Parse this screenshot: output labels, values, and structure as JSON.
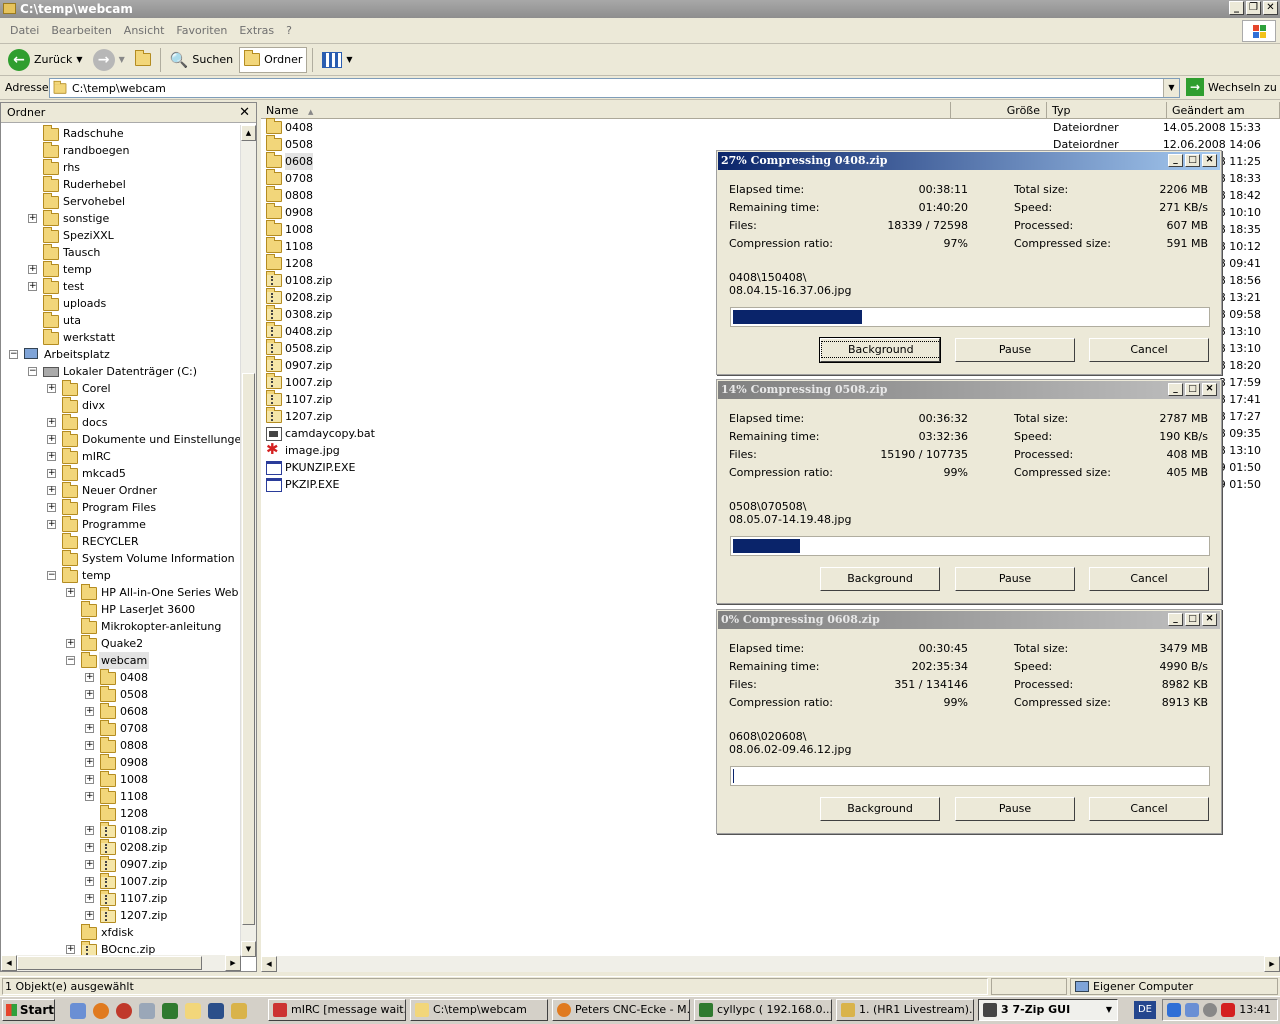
{
  "window": {
    "title": "C:\\temp\\webcam"
  },
  "menu": [
    "Datei",
    "Bearbeiten",
    "Ansicht",
    "Favoriten",
    "Extras",
    "?"
  ],
  "toolbar": {
    "back": "Zurück",
    "search": "Suchen",
    "folders": "Ordner"
  },
  "address": {
    "label": "Adresse",
    "value": "C:\\temp\\webcam",
    "go": "Wechseln zu"
  },
  "folder_pane": {
    "title": "Ordner"
  },
  "tree": [
    {
      "label": "Radschuhe",
      "indent": 1,
      "exp": ""
    },
    {
      "label": "randboegen",
      "indent": 1,
      "exp": ""
    },
    {
      "label": "rhs",
      "indent": 1,
      "exp": ""
    },
    {
      "label": "Ruderhebel",
      "indent": 1,
      "exp": ""
    },
    {
      "label": "Servohebel",
      "indent": 1,
      "exp": ""
    },
    {
      "label": "sonstige",
      "indent": 1,
      "exp": "+"
    },
    {
      "label": "SpeziXXL",
      "indent": 1,
      "exp": ""
    },
    {
      "label": "Tausch",
      "indent": 1,
      "exp": ""
    },
    {
      "label": "temp",
      "indent": 1,
      "exp": "+"
    },
    {
      "label": "test",
      "indent": 1,
      "exp": "+"
    },
    {
      "label": "uploads",
      "indent": 1,
      "exp": ""
    },
    {
      "label": "uta",
      "indent": 1,
      "exp": ""
    },
    {
      "label": "werkstatt",
      "indent": 1,
      "exp": ""
    },
    {
      "label": "Arbeitsplatz",
      "indent": 0,
      "exp": "-",
      "icon": "pc"
    },
    {
      "label": "Lokaler Datenträger (C:)",
      "indent": 1,
      "exp": "-",
      "icon": "drive"
    },
    {
      "label": "Corel",
      "indent": 2,
      "exp": "+"
    },
    {
      "label": "divx",
      "indent": 2,
      "exp": ""
    },
    {
      "label": "docs",
      "indent": 2,
      "exp": "+"
    },
    {
      "label": "Dokumente und Einstellungen",
      "indent": 2,
      "exp": "+"
    },
    {
      "label": "mIRC",
      "indent": 2,
      "exp": "+"
    },
    {
      "label": "mkcad5",
      "indent": 2,
      "exp": "+"
    },
    {
      "label": "Neuer Ordner",
      "indent": 2,
      "exp": "+"
    },
    {
      "label": "Program Files",
      "indent": 2,
      "exp": "+"
    },
    {
      "label": "Programme",
      "indent": 2,
      "exp": "+"
    },
    {
      "label": "RECYCLER",
      "indent": 2,
      "exp": ""
    },
    {
      "label": "System Volume Information",
      "indent": 2,
      "exp": ""
    },
    {
      "label": "temp",
      "indent": 2,
      "exp": "-"
    },
    {
      "label": "HP All-in-One Series Web Rel",
      "indent": 3,
      "exp": "+"
    },
    {
      "label": "HP LaserJet 3600",
      "indent": 3,
      "exp": ""
    },
    {
      "label": "Mikrokopter-anleitung",
      "indent": 3,
      "exp": ""
    },
    {
      "label": "Quake2",
      "indent": 3,
      "exp": "+"
    },
    {
      "label": "webcam",
      "indent": 3,
      "exp": "-",
      "sel": true
    },
    {
      "label": "0408",
      "indent": 4,
      "exp": "+"
    },
    {
      "label": "0508",
      "indent": 4,
      "exp": "+"
    },
    {
      "label": "0608",
      "indent": 4,
      "exp": "+"
    },
    {
      "label": "0708",
      "indent": 4,
      "exp": "+"
    },
    {
      "label": "0808",
      "indent": 4,
      "exp": "+"
    },
    {
      "label": "0908",
      "indent": 4,
      "exp": "+"
    },
    {
      "label": "1008",
      "indent": 4,
      "exp": "+"
    },
    {
      "label": "1108",
      "indent": 4,
      "exp": "+"
    },
    {
      "label": "1208",
      "indent": 4,
      "exp": ""
    },
    {
      "label": "0108.zip",
      "indent": 4,
      "exp": "+",
      "icon": "zip"
    },
    {
      "label": "0208.zip",
      "indent": 4,
      "exp": "+",
      "icon": "zip"
    },
    {
      "label": "0907.zip",
      "indent": 4,
      "exp": "+",
      "icon": "zip"
    },
    {
      "label": "1007.zip",
      "indent": 4,
      "exp": "+",
      "icon": "zip"
    },
    {
      "label": "1107.zip",
      "indent": 4,
      "exp": "+",
      "icon": "zip"
    },
    {
      "label": "1207.zip",
      "indent": 4,
      "exp": "+",
      "icon": "zip"
    },
    {
      "label": "xfdisk",
      "indent": 3,
      "exp": ""
    },
    {
      "label": "BOcnc.zip",
      "indent": 3,
      "exp": "+",
      "icon": "zip"
    }
  ],
  "columns": {
    "name": "Name",
    "size": "Größe",
    "type": "Typ",
    "modified": "Geändert am"
  },
  "files": [
    {
      "name": "0408",
      "icon": "folder"
    },
    {
      "name": "0508",
      "icon": "folder"
    },
    {
      "name": "0608",
      "icon": "folder",
      "sel": true
    },
    {
      "name": "0708",
      "icon": "folder"
    },
    {
      "name": "0808",
      "icon": "folder"
    },
    {
      "name": "0908",
      "icon": "folder"
    },
    {
      "name": "1008",
      "icon": "folder"
    },
    {
      "name": "1108",
      "icon": "folder"
    },
    {
      "name": "1208",
      "icon": "folder"
    },
    {
      "name": "0108.zip",
      "icon": "zip"
    },
    {
      "name": "0208.zip",
      "icon": "zip"
    },
    {
      "name": "0308.zip",
      "icon": "zip"
    },
    {
      "name": "0408.zip",
      "icon": "zip"
    },
    {
      "name": "0508.zip",
      "icon": "zip"
    },
    {
      "name": "0907.zip",
      "icon": "zip"
    },
    {
      "name": "1007.zip",
      "icon": "zip"
    },
    {
      "name": "1107.zip",
      "icon": "zip"
    },
    {
      "name": "1207.zip",
      "icon": "zip"
    },
    {
      "name": "camdaycopy.bat",
      "icon": "bat"
    },
    {
      "name": "image.jpg",
      "icon": "img"
    },
    {
      "name": "PKUNZIP.EXE",
      "icon": "exe"
    },
    {
      "name": "PKZIP.EXE",
      "icon": "exe"
    }
  ],
  "visible_types": [
    "Dateiordner",
    "Dateiordner"
  ],
  "visible_dates": [
    "14.05.2008 15:33",
    "12.06.2008 14:06",
    "8 11:25",
    "8 18:33",
    "8 18:42",
    "8 10:10",
    "8 18:35",
    "8 10:12",
    "8 09:41",
    "8 18:56",
    "8 13:21",
    "8 09:58",
    "8 13:10",
    "8 13:10",
    "8 18:20",
    "8 17:59",
    "8 17:41",
    "8 17:27",
    "8 09:35",
    "8 13:10",
    "9 01:50",
    "9 01:50"
  ],
  "dialogs": [
    {
      "title": "27% Compressing 0408.zip",
      "active": true,
      "elapsed": "00:38:11",
      "remaining": "01:40:20",
      "files": "18339 / 72598",
      "ratio": "97%",
      "total": "2206 MB",
      "speed": "271 KB/s",
      "processed": "607 MB",
      "compressed": "591 MB",
      "path1": "0408\\150408\\",
      "path2": "08.04.15-16.37.06.jpg",
      "progress": 0.27
    },
    {
      "title": "14% Compressing 0508.zip",
      "active": false,
      "elapsed": "00:36:32",
      "remaining": "03:32:36",
      "files": "15190 / 107735",
      "ratio": "99%",
      "total": "2787 MB",
      "speed": "190 KB/s",
      "processed": "408 MB",
      "compressed": "405 MB",
      "path1": "0508\\070508\\",
      "path2": "08.05.07-14.19.48.jpg",
      "progress": 0.14
    },
    {
      "title": "0% Compressing 0608.zip",
      "active": false,
      "elapsed": "00:30:45",
      "remaining": "202:35:34",
      "files": "351 / 134146",
      "ratio": "99%",
      "total": "3479 MB",
      "speed": "4990 B/s",
      "processed": "8982 KB",
      "compressed": "8913 KB",
      "path1": "0608\\020608\\",
      "path2": "08.06.02-09.46.12.jpg",
      "progress": 0.0
    }
  ],
  "dialog_labels": {
    "elapsed": "Elapsed time:",
    "remaining": "Remaining time:",
    "files": "Files:",
    "ratio": "Compression ratio:",
    "total": "Total size:",
    "speed": "Speed:",
    "processed": "Processed:",
    "compressed": "Compressed size:",
    "background": "Background",
    "pause": "Pause",
    "cancel": "Cancel"
  },
  "status": {
    "left": "1 Objekt(e) ausgewählt",
    "right": "Eigener Computer"
  },
  "taskbar": {
    "start": "Start",
    "tasks": [
      "mIRC [message wait...",
      "C:\\temp\\webcam",
      "Peters CNC-Ecke - M...",
      "cyllypc ( 192.168.0....",
      "1.  (HR1 Livestream)...",
      "3 7-Zip GUI"
    ],
    "lang": "DE",
    "clock": "13:41"
  }
}
